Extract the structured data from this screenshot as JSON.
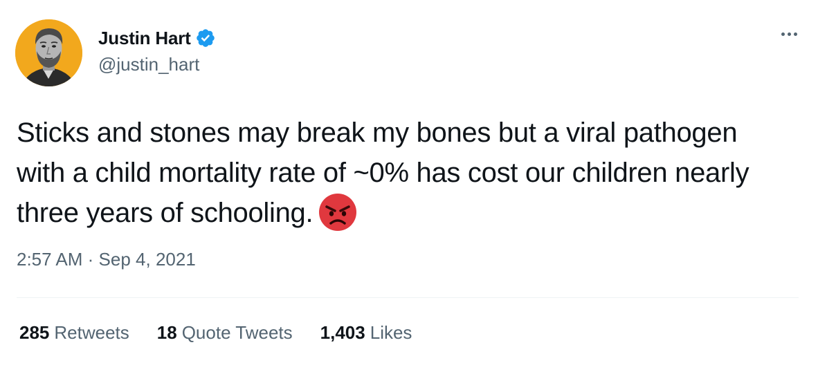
{
  "author": {
    "display_name": "Justin Hart",
    "handle": "@justin_hart",
    "verified": true,
    "avatar_bg_color": "#f2a81d"
  },
  "tweet": {
    "text": "Sticks and stones may break my bones but a viral pathogen with a child mortality rate of ~0% has cost our children nearly three years of schooling.",
    "emoji": "angry-face-icon",
    "time": "2:57 AM",
    "separator": "·",
    "date": "Sep 4, 2021"
  },
  "stats": {
    "retweets_count": "285",
    "retweets_label": "Retweets",
    "quotes_count": "18",
    "quotes_label": "Quote Tweets",
    "likes_count": "1,403",
    "likes_label": "Likes"
  },
  "colors": {
    "verified_blue": "#1d9bf0",
    "secondary_text": "#536471",
    "primary_text": "#0f1419",
    "angry_red": "#e0383e"
  }
}
